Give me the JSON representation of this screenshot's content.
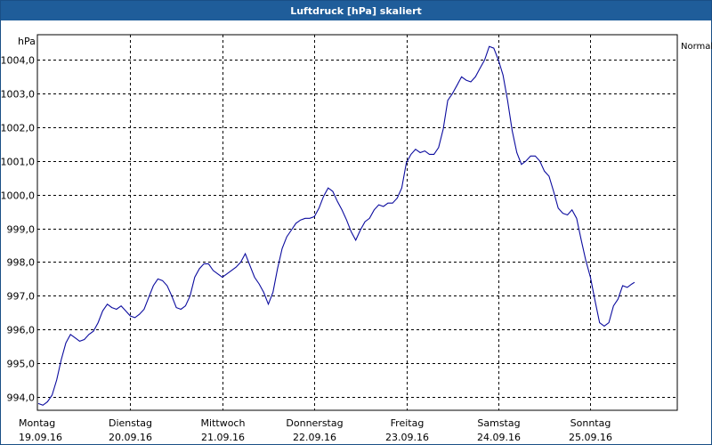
{
  "window": {
    "title": "Luftdruck [hPa] skaliert"
  },
  "colors": {
    "title_bar": "#1f5d9a",
    "line": "#0b0b9e",
    "grid": "#000000"
  },
  "chart_data": {
    "type": "line",
    "title": "Luftdruck [hPa] skaliert",
    "ylabel": "hPa",
    "xlabel": "",
    "ylim": [
      993.6,
      1004.75
    ],
    "grid": true,
    "grid_style": "dashed",
    "legend_entries": [
      "Normal"
    ],
    "legend_position": "top-right",
    "yticks": [
      994.0,
      995.0,
      996.0,
      997.0,
      998.0,
      999.0,
      1000.0,
      1001.0,
      1002.0,
      1003.0,
      1004.0
    ],
    "ytick_labels": [
      "994,0",
      "995,0",
      "996,0",
      "997,0",
      "998,0",
      "999,0",
      "1000,0",
      "1001,0",
      "1002,0",
      "1003,0",
      "1004,0"
    ],
    "xticks": [
      {
        "day": "Montag",
        "date": "19.09.16",
        "x": 0
      },
      {
        "day": "Dienstag",
        "date": "20.09.16",
        "x": 1
      },
      {
        "day": "Mittwoch",
        "date": "21.09.16",
        "x": 2
      },
      {
        "day": "Donnerstag",
        "date": "22.09.16",
        "x": 3
      },
      {
        "day": "Freitag",
        "date": "23.09.16",
        "x": 4
      },
      {
        "day": "Samstag",
        "date": "24.09.16",
        "x": 5
      },
      {
        "day": "Sonntag",
        "date": "25.09.16",
        "x": 6
      }
    ],
    "xlim": [
      0,
      7
    ],
    "series": [
      {
        "name": "Normal",
        "points": [
          [
            0.0,
            993.8
          ],
          [
            0.05,
            993.75
          ],
          [
            0.1,
            993.85
          ],
          [
            0.15,
            994.05
          ],
          [
            0.2,
            994.5
          ],
          [
            0.25,
            995.1
          ],
          [
            0.3,
            995.6
          ],
          [
            0.35,
            995.85
          ],
          [
            0.4,
            995.75
          ],
          [
            0.45,
            995.65
          ],
          [
            0.5,
            995.7
          ],
          [
            0.55,
            995.85
          ],
          [
            0.6,
            995.95
          ],
          [
            0.65,
            996.2
          ],
          [
            0.7,
            996.55
          ],
          [
            0.75,
            996.75
          ],
          [
            0.8,
            996.65
          ],
          [
            0.85,
            996.6
          ],
          [
            0.9,
            996.7
          ],
          [
            0.95,
            996.55
          ],
          [
            1.0,
            996.4
          ],
          [
            1.05,
            996.35
          ],
          [
            1.1,
            996.45
          ],
          [
            1.15,
            996.6
          ],
          [
            1.2,
            996.95
          ],
          [
            1.25,
            997.3
          ],
          [
            1.3,
            997.5
          ],
          [
            1.35,
            997.45
          ],
          [
            1.4,
            997.3
          ],
          [
            1.45,
            997.0
          ],
          [
            1.5,
            996.65
          ],
          [
            1.55,
            996.6
          ],
          [
            1.6,
            996.7
          ],
          [
            1.65,
            997.0
          ],
          [
            1.7,
            997.55
          ],
          [
            1.75,
            997.8
          ],
          [
            1.8,
            997.95
          ],
          [
            1.85,
            997.95
          ],
          [
            1.9,
            997.75
          ],
          [
            1.95,
            997.65
          ],
          [
            2.0,
            997.55
          ],
          [
            2.05,
            997.65
          ],
          [
            2.1,
            997.75
          ],
          [
            2.15,
            997.85
          ],
          [
            2.2,
            998.0
          ],
          [
            2.25,
            998.25
          ],
          [
            2.3,
            997.9
          ],
          [
            2.35,
            997.55
          ],
          [
            2.4,
            997.35
          ],
          [
            2.45,
            997.1
          ],
          [
            2.5,
            996.75
          ],
          [
            2.55,
            997.1
          ],
          [
            2.6,
            997.8
          ],
          [
            2.65,
            998.4
          ],
          [
            2.7,
            998.75
          ],
          [
            2.75,
            998.95
          ],
          [
            2.8,
            999.15
          ],
          [
            2.85,
            999.25
          ],
          [
            2.9,
            999.3
          ],
          [
            2.95,
            999.3
          ],
          [
            3.0,
            999.35
          ],
          [
            3.05,
            999.6
          ],
          [
            3.1,
            999.95
          ],
          [
            3.15,
            1000.2
          ],
          [
            3.2,
            1000.1
          ],
          [
            3.25,
            999.8
          ],
          [
            3.3,
            999.55
          ],
          [
            3.35,
            999.25
          ],
          [
            3.4,
            998.9
          ],
          [
            3.45,
            998.65
          ],
          [
            3.5,
            998.95
          ],
          [
            3.55,
            999.2
          ],
          [
            3.6,
            999.3
          ],
          [
            3.65,
            999.55
          ],
          [
            3.7,
            999.7
          ],
          [
            3.75,
            999.65
          ],
          [
            3.8,
            999.75
          ],
          [
            3.85,
            999.75
          ],
          [
            3.9,
            999.9
          ],
          [
            3.95,
            1000.2
          ],
          [
            4.0,
            1000.95
          ],
          [
            4.05,
            1001.2
          ],
          [
            4.1,
            1001.35
          ],
          [
            4.15,
            1001.25
          ],
          [
            4.2,
            1001.3
          ],
          [
            4.25,
            1001.2
          ],
          [
            4.3,
            1001.2
          ],
          [
            4.35,
            1001.4
          ],
          [
            4.4,
            1001.95
          ],
          [
            4.45,
            1002.8
          ],
          [
            4.5,
            1003.0
          ],
          [
            4.55,
            1003.25
          ],
          [
            4.6,
            1003.5
          ],
          [
            4.65,
            1003.4
          ],
          [
            4.7,
            1003.35
          ],
          [
            4.75,
            1003.5
          ],
          [
            4.8,
            1003.75
          ],
          [
            4.85,
            1004.0
          ],
          [
            4.9,
            1004.4
          ],
          [
            4.95,
            1004.35
          ],
          [
            5.0,
            1004.0
          ],
          [
            5.05,
            1003.55
          ],
          [
            5.1,
            1002.8
          ],
          [
            5.15,
            1001.9
          ],
          [
            5.2,
            1001.25
          ],
          [
            5.25,
            1000.9
          ],
          [
            5.3,
            1001.0
          ],
          [
            5.35,
            1001.15
          ],
          [
            5.4,
            1001.15
          ],
          [
            5.45,
            1001.0
          ],
          [
            5.5,
            1000.7
          ],
          [
            5.55,
            1000.55
          ],
          [
            5.6,
            1000.1
          ],
          [
            5.65,
            999.6
          ],
          [
            5.7,
            999.45
          ],
          [
            5.75,
            999.4
          ],
          [
            5.8,
            999.55
          ],
          [
            5.85,
            999.3
          ],
          [
            5.9,
            998.65
          ],
          [
            5.95,
            998.05
          ],
          [
            6.0,
            997.55
          ],
          [
            6.05,
            996.85
          ],
          [
            6.1,
            996.2
          ],
          [
            6.15,
            996.1
          ],
          [
            6.2,
            996.2
          ],
          [
            6.25,
            996.7
          ],
          [
            6.3,
            996.9
          ],
          [
            6.35,
            997.3
          ],
          [
            6.4,
            997.25
          ],
          [
            6.45,
            997.35
          ],
          [
            6.48,
            997.4
          ]
        ]
      }
    ]
  }
}
